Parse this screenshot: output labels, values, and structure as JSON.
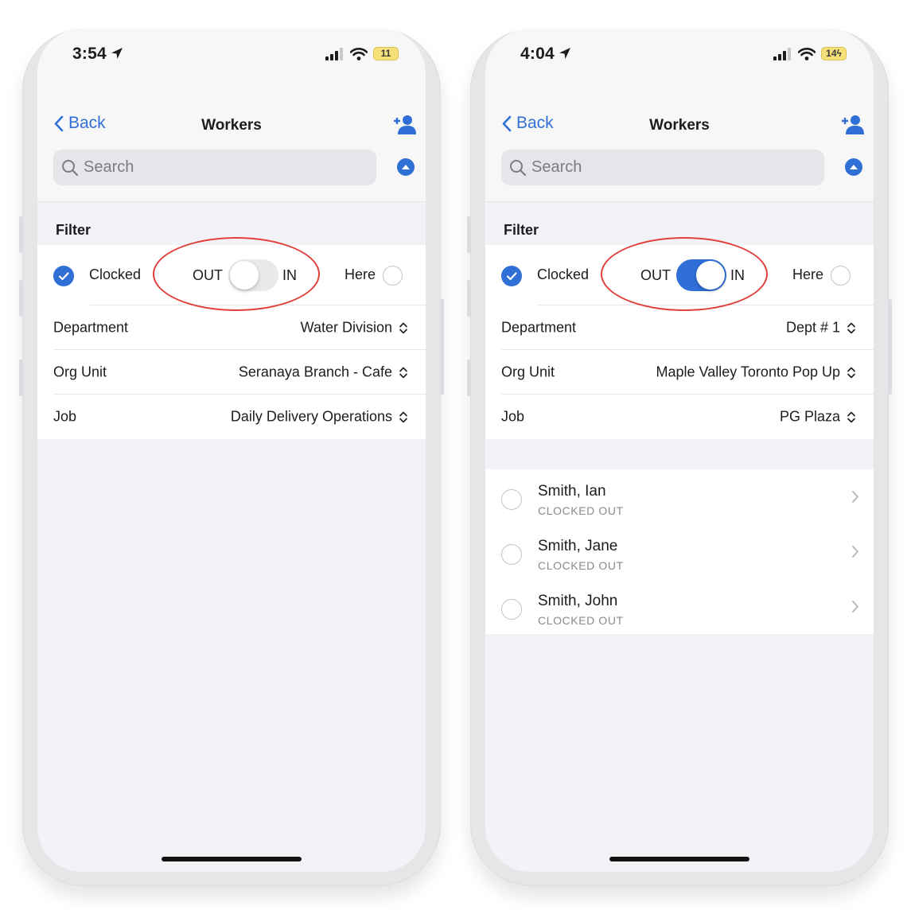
{
  "colors": {
    "accent": "#2f6fd6",
    "highlight": "#e0413a",
    "toggle_off": "#e9e9eb"
  },
  "phones": [
    {
      "status": {
        "time": "3:54",
        "battery": "11"
      },
      "nav": {
        "back": "Back",
        "title": "Workers"
      },
      "search": {
        "placeholder": "Search"
      },
      "filter": {
        "section": "Filter",
        "clocked": "Clocked",
        "out": "OUT",
        "in": "IN",
        "here": "Here",
        "toggle_on": false,
        "rows": [
          {
            "label": "Department",
            "value": "Water Division"
          },
          {
            "label": "Org Unit",
            "value": "Seranaya Branch - Cafe"
          },
          {
            "label": "Job",
            "value": "Daily Delivery Operations"
          }
        ]
      },
      "workers": []
    },
    {
      "status": {
        "time": "4:04",
        "battery": "14"
      },
      "nav": {
        "back": "Back",
        "title": "Workers"
      },
      "search": {
        "placeholder": "Search"
      },
      "filter": {
        "section": "Filter",
        "clocked": "Clocked",
        "out": "OUT",
        "in": "IN",
        "here": "Here",
        "toggle_on": true,
        "rows": [
          {
            "label": "Department",
            "value": "Dept # 1"
          },
          {
            "label": "Org Unit",
            "value": "Maple Valley Toronto Pop Up"
          },
          {
            "label": "Job",
            "value": "PG Plaza"
          }
        ]
      },
      "workers": [
        {
          "name": "Smith, Ian",
          "status": "CLOCKED OUT"
        },
        {
          "name": "Smith, Jane",
          "status": "CLOCKED OUT"
        },
        {
          "name": "Smith, John",
          "status": "CLOCKED OUT"
        }
      ]
    }
  ]
}
